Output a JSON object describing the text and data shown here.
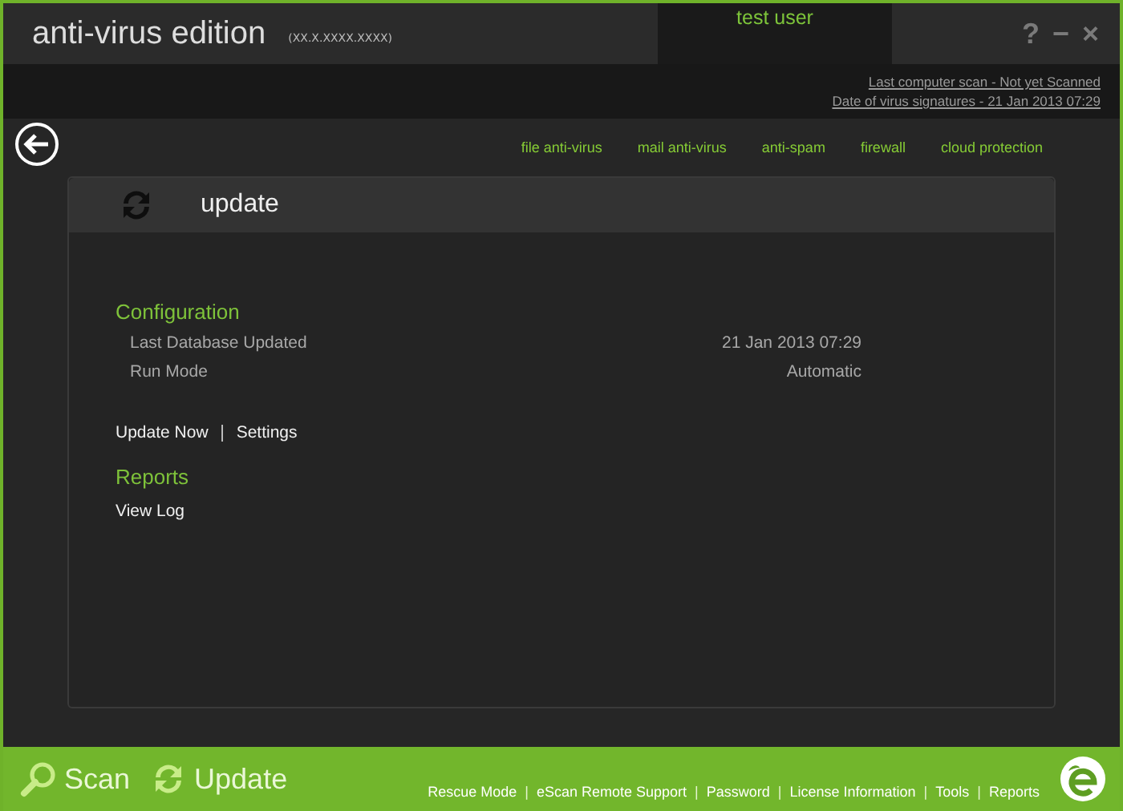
{
  "header": {
    "title": "anti-virus edition",
    "version": "(XX.X.XXXX.XXXX)",
    "user": "test user",
    "window_controls": [
      "?",
      "−",
      "×"
    ]
  },
  "status_links": [
    "Last computer scan - Not yet Scanned",
    "Date of  virus signatures - 21 Jan 2013 07:29"
  ],
  "nav": [
    "file anti-virus",
    "mail anti-virus",
    "anti-spam",
    "firewall",
    "cloud protection"
  ],
  "panel": {
    "title": "update",
    "configuration": {
      "heading": "Configuration",
      "rows": [
        {
          "label": "Last Database Updated",
          "value": "21 Jan 2013 07:29"
        },
        {
          "label": "Run Mode",
          "value": "Automatic"
        }
      ]
    },
    "actions": [
      {
        "kind": "link",
        "text": "Update Now"
      },
      {
        "kind": "separator",
        "text": "|"
      },
      {
        "kind": "link",
        "text": "Settings"
      }
    ],
    "reports": {
      "heading": "Reports",
      "links": [
        "View Log"
      ]
    }
  },
  "footer": {
    "buttons": [
      {
        "kind": "scan",
        "label": "Scan"
      },
      {
        "kind": "update",
        "label": "Update"
      }
    ],
    "links": [
      {
        "kind": "link",
        "text": "Rescue Mode"
      },
      {
        "kind": "separator",
        "text": "|"
      },
      {
        "kind": "link",
        "text": "eScan Remote Support"
      },
      {
        "kind": "separator",
        "text": "|"
      },
      {
        "kind": "link",
        "text": "Password"
      },
      {
        "kind": "separator",
        "text": "|"
      },
      {
        "kind": "link",
        "text": "License Information"
      },
      {
        "kind": "separator",
        "text": "|"
      },
      {
        "kind": "link",
        "text": "Tools"
      },
      {
        "kind": "separator",
        "text": "|"
      },
      {
        "kind": "link",
        "text": "Reports"
      }
    ]
  }
}
